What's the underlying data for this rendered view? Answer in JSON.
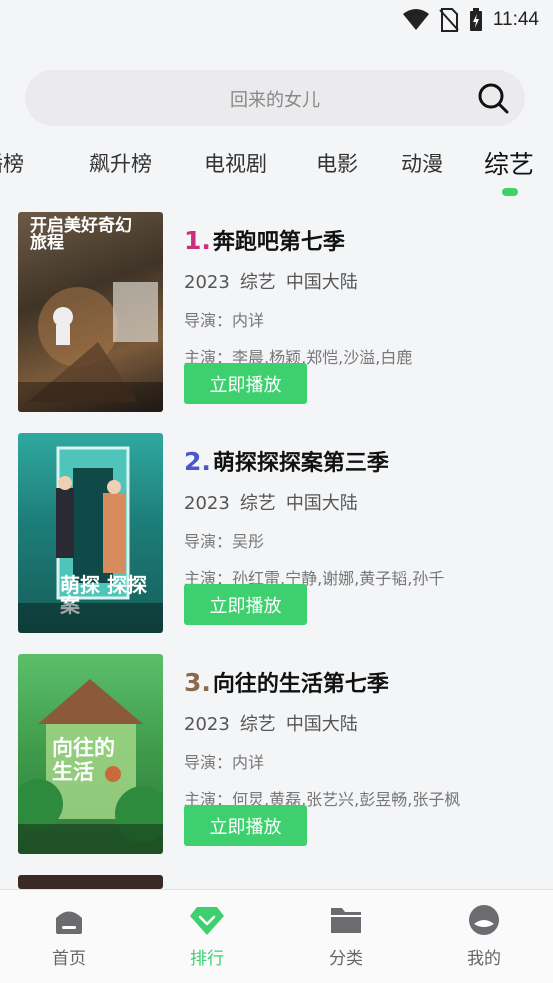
{
  "status_bar": {
    "time": "11:44"
  },
  "search": {
    "placeholder": "回来的女儿"
  },
  "tabs": [
    {
      "label": "播榜"
    },
    {
      "label": "飙升榜"
    },
    {
      "label": "电视剧"
    },
    {
      "label": "电影"
    },
    {
      "label": "动漫"
    },
    {
      "label": "综艺"
    }
  ],
  "active_tab": "综艺",
  "accent_color": "#3ed06f",
  "items": [
    {
      "rank": "1.",
      "rank_color": "#c8307a",
      "title": "奔跑吧第七季",
      "year": "2023",
      "genre": "综艺",
      "region": "中国大陆",
      "director": "导演：内详",
      "cast": "主演：李晨,杨颖,郑恺,沙溢,白鹿",
      "play_label": "立即播放",
      "poster_text": "开启美好奇幻旅程"
    },
    {
      "rank": "2.",
      "rank_color": "#4b57c8",
      "title": "萌探探探案第三季",
      "year": "2023",
      "genre": "综艺",
      "region": "中国大陆",
      "director": "导演：吴彤",
      "cast": "主演：孙红雷,宁静,谢娜,黄子韬,孙千",
      "play_label": "立即播放",
      "poster_text": "萌探 探探案"
    },
    {
      "rank": "3.",
      "rank_color": "#8a6a4a",
      "title": "向往的生活第七季",
      "year": "2023",
      "genre": "综艺",
      "region": "中国大陆",
      "director": "导演：内详",
      "cast": "主演：何炅,黄磊,张艺兴,彭昱畅,张子枫",
      "play_label": "立即播放",
      "poster_text": "向往的生活"
    }
  ],
  "bottom_nav": [
    {
      "label": "首页",
      "icon": "home-icon"
    },
    {
      "label": "排行",
      "icon": "diamond-icon"
    },
    {
      "label": "分类",
      "icon": "folder-icon"
    },
    {
      "label": "我的",
      "icon": "profile-icon"
    }
  ]
}
